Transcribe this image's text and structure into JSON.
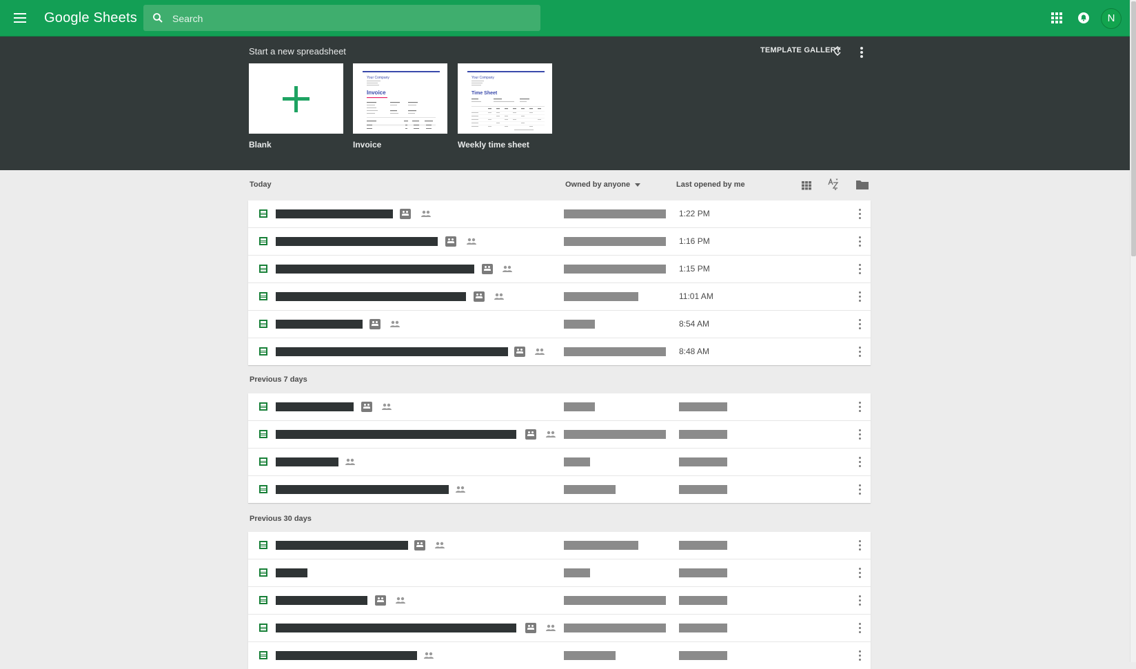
{
  "header": {
    "brand": "Google Sheets",
    "search_placeholder": "Search",
    "avatar_initial": "N",
    "accent": "#139f55"
  },
  "templates": {
    "heading": "Start a new spreadsheet",
    "gallery_label": "TEMPLATE GALLERY",
    "items": [
      {
        "label": "Blank"
      },
      {
        "label": "Invoice"
      },
      {
        "label": "Weekly time sheet"
      }
    ],
    "invoice_preview": {
      "company": "Your Company",
      "title": "Invoice"
    },
    "timesheet_preview": {
      "company": "Your Company",
      "title": "Time Sheet"
    }
  },
  "list": {
    "owner_filter": "Owned by anyone",
    "sort_label": "Last opened by me",
    "sections": [
      {
        "title": "Today",
        "rows": [
          {
            "time": "1:22 PM"
          },
          {
            "time": "1:16 PM"
          },
          {
            "time": "1:15 PM"
          },
          {
            "time": "11:01 AM"
          },
          {
            "time": "8:54 AM"
          },
          {
            "time": "8:48 AM"
          }
        ]
      },
      {
        "title": "Previous 7 days"
      },
      {
        "title": "Previous 30 days"
      }
    ]
  }
}
